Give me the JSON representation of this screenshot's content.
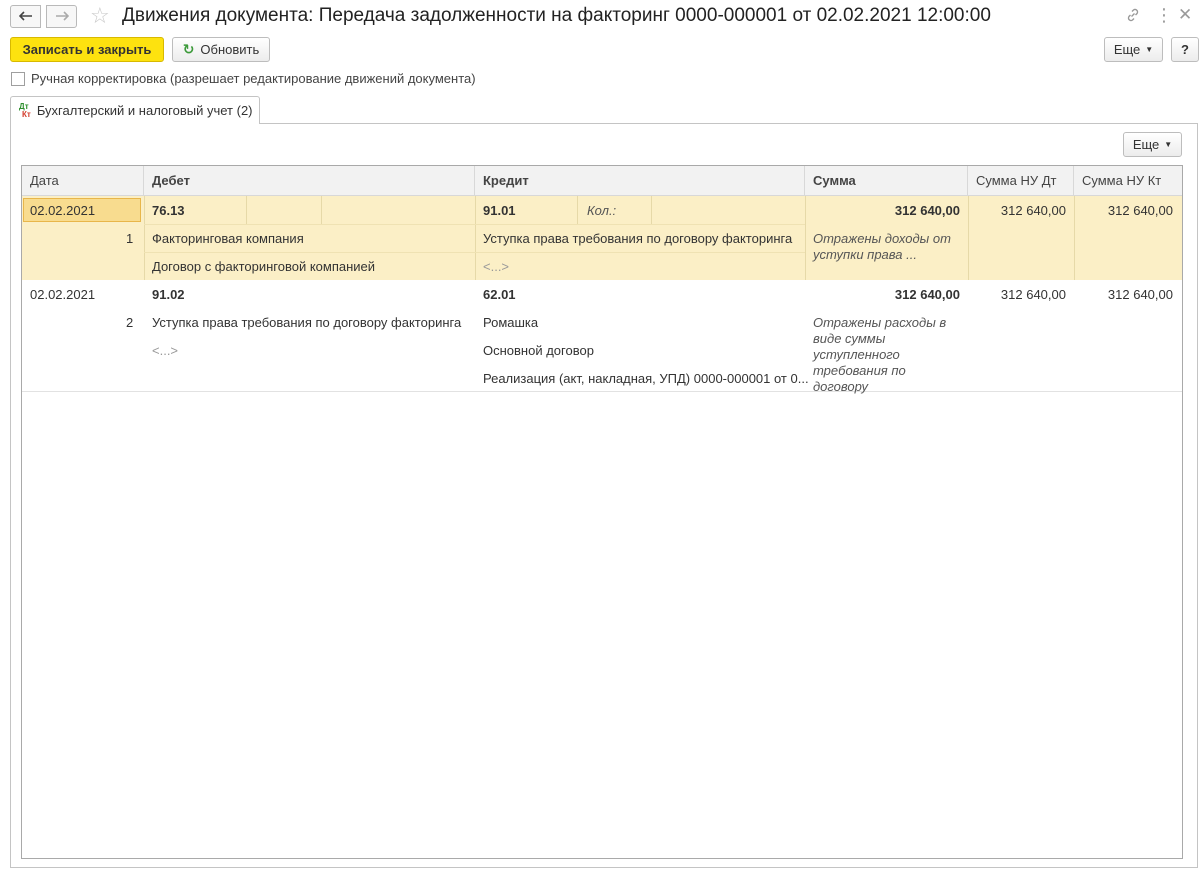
{
  "title": "Движения документа: Передача задолженности на факторинг 0000-000001 от 02.02.2021 12:00:00",
  "nav": {
    "back_icon": "arrow-left-icon",
    "forward_icon": "arrow-right-icon",
    "favorite_icon": "star-icon"
  },
  "toolbar": {
    "save_close_label": "Записать и закрыть",
    "refresh_label": "Обновить",
    "more_label": "Еще",
    "help_label": "?"
  },
  "manual_correction": {
    "label": "Ручная корректировка (разрешает редактирование движений документа)",
    "checked": false
  },
  "tab": {
    "label": "Бухгалтерский и налоговый учет (2)",
    "icon_top": "Дт",
    "icon_bottom": "Кт"
  },
  "table": {
    "more_label": "Еще",
    "columns": [
      "Дата",
      "Дебет",
      "Кредит",
      "Сумма",
      "Сумма НУ Дт",
      "Сумма НУ Кт"
    ],
    "rows": [
      {
        "date": "02.02.2021",
        "number": "1",
        "debit_account": "76.13",
        "debit_sub1": "Факторинговая компания",
        "debit_sub2": "Договор с факторинговой компанией",
        "credit_account": "91.01",
        "credit_qty": "Кол.:",
        "credit_sub1": "Уступка права требования по договору факторинга",
        "credit_sub2": "<...>",
        "amount": "312 640,00",
        "comment": "Отражены доходы от уступки права ...",
        "amount_nu_dt": "312 640,00",
        "amount_nu_kt": "312 640,00"
      },
      {
        "date": "02.02.2021",
        "number": "2",
        "debit_account": "91.02",
        "debit_sub1": "Уступка права требования по договору факторинга",
        "debit_sub2": "<...>",
        "credit_account": "62.01",
        "credit_sub1": "Ромашка",
        "credit_sub2": "Основной договор",
        "credit_sub3": "Реализация (акт, накладная, УПД) 0000-000001 от 0...",
        "amount": "312 640,00",
        "comment": "Отражены расходы в виде суммы уступленного требования по договору",
        "amount_nu_dt": "312 640,00",
        "amount_nu_kt": "312 640,00"
      }
    ]
  }
}
